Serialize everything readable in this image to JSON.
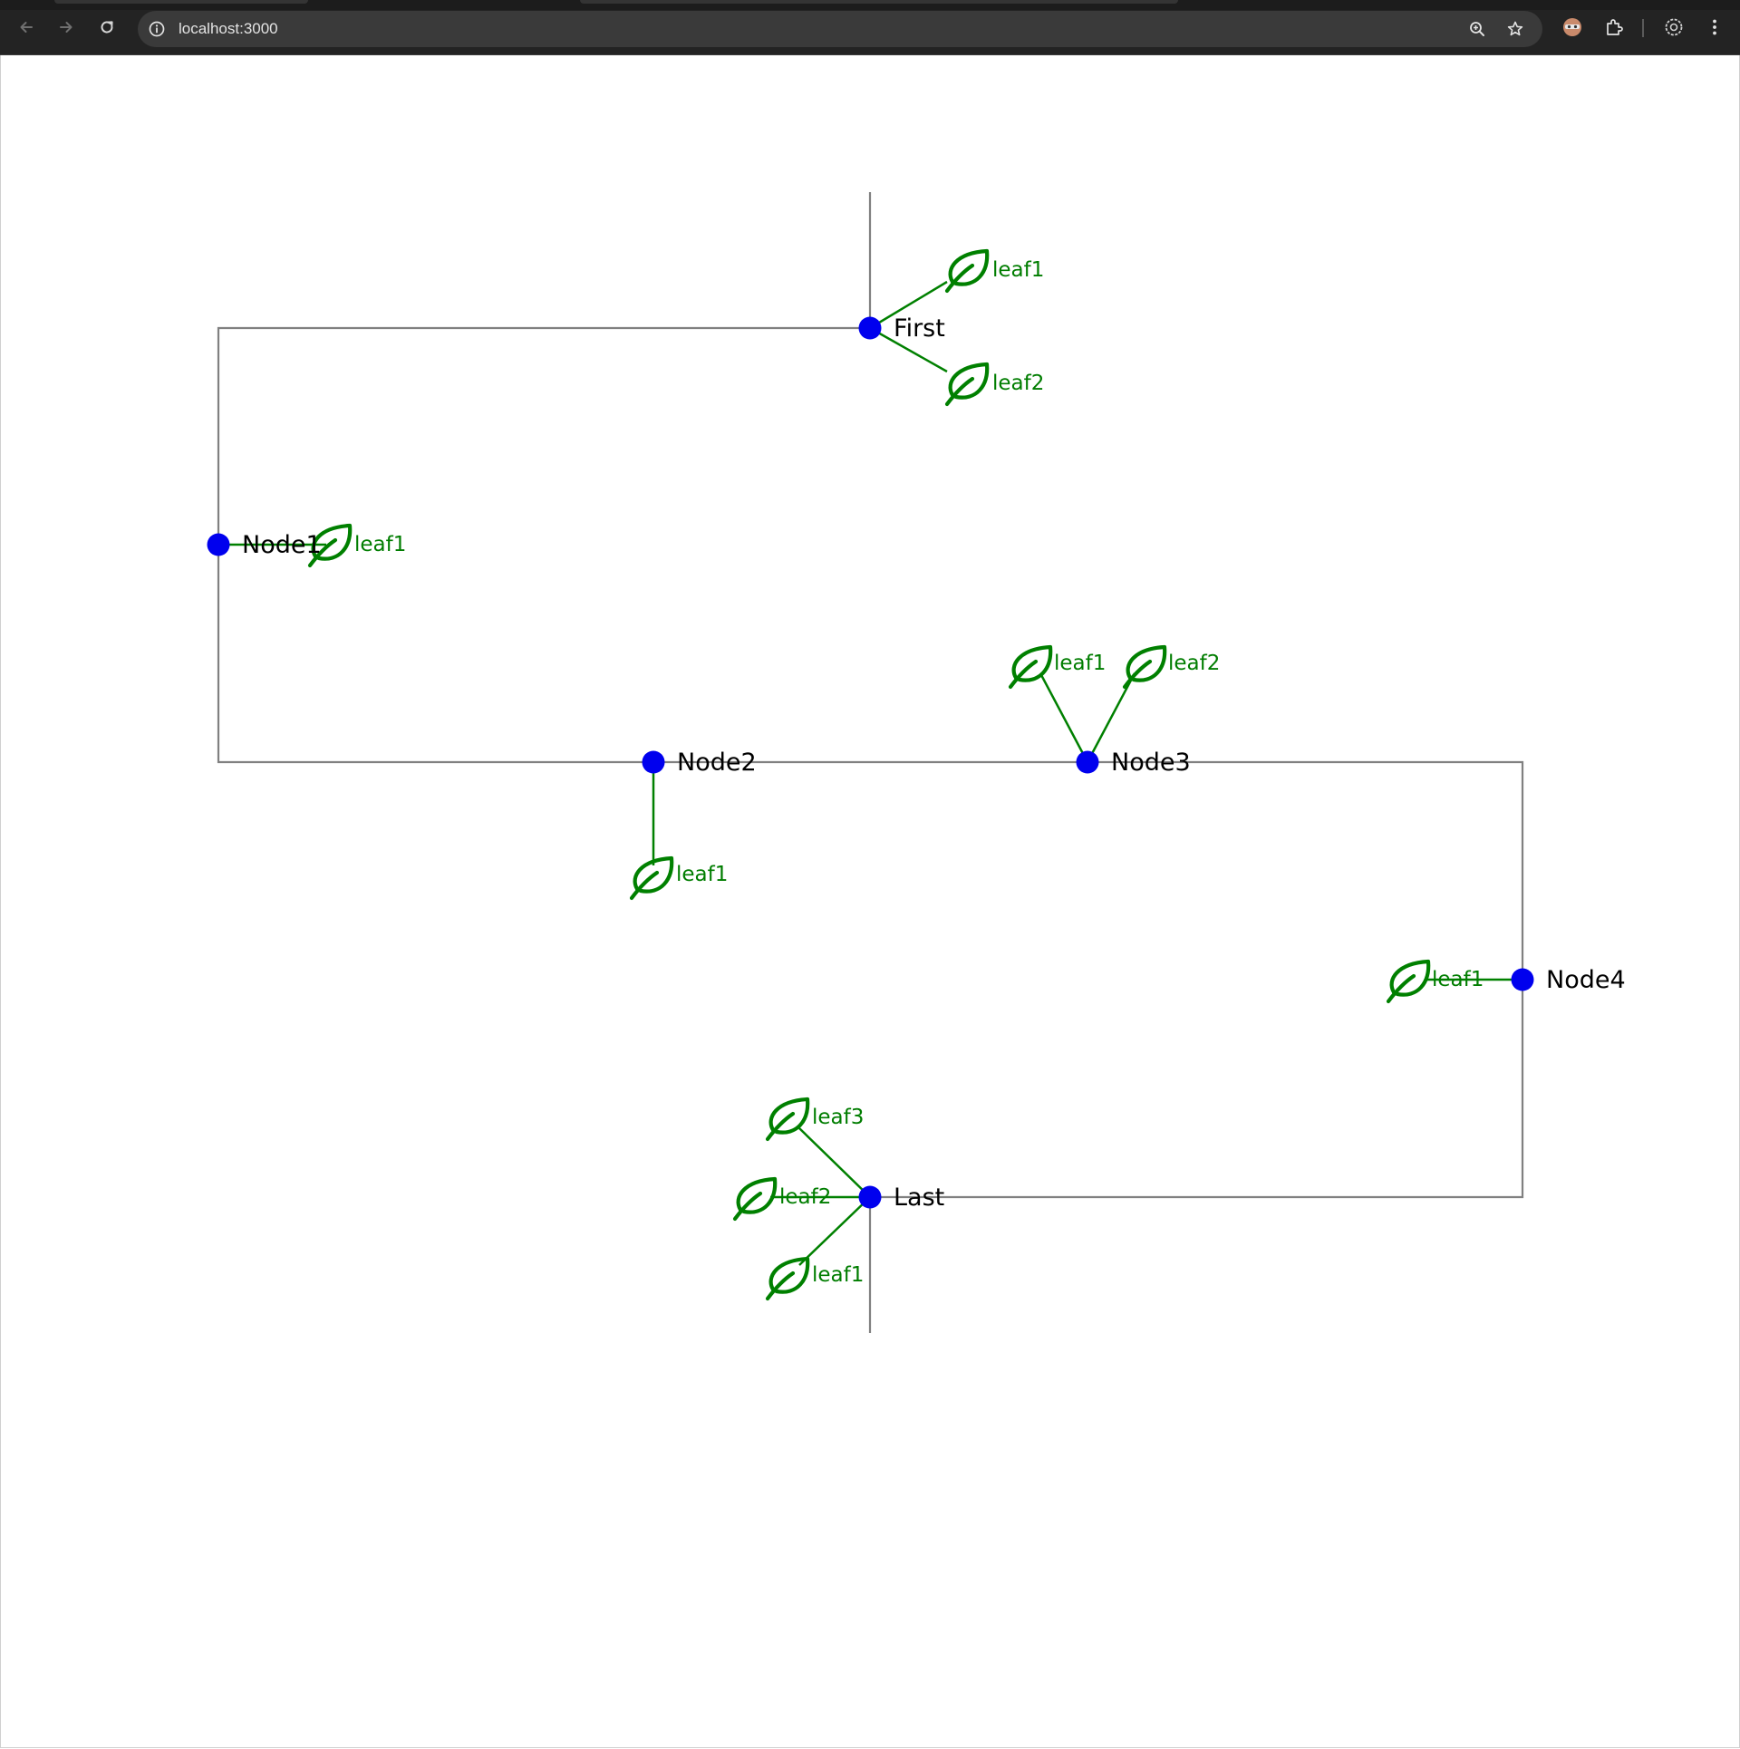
{
  "browser": {
    "url": "localhost:3000",
    "icons": {
      "back": "arrow-left-icon",
      "forward": "arrow-right-icon",
      "reload": "reload-icon",
      "site_info": "info-icon",
      "zoom": "zoom-in-icon",
      "bookmark": "star-icon",
      "profile_extension": "avatar-extension-icon",
      "extensions": "puzzle-icon",
      "settings_extension": "gear-icon",
      "menu": "kebab-menu-icon"
    }
  },
  "colors": {
    "node_fill": "#0000ee",
    "edge_stroke": "#808080",
    "leaf_stroke": "#008000",
    "leaf_label": "#007d00",
    "node_label": "#000000",
    "browser_chrome": "#232323"
  },
  "graph": {
    "nodes": [
      {
        "id": "first",
        "label": "First",
        "leaves": [
          {
            "label": "leaf1"
          },
          {
            "label": "leaf2"
          }
        ]
      },
      {
        "id": "node1",
        "label": "Node1",
        "leaves": [
          {
            "label": "leaf1"
          }
        ]
      },
      {
        "id": "node2",
        "label": "Node2",
        "leaves": [
          {
            "label": "leaf1"
          }
        ]
      },
      {
        "id": "node3",
        "label": "Node3",
        "leaves": [
          {
            "label": "leaf1"
          },
          {
            "label": "leaf2"
          }
        ]
      },
      {
        "id": "node4",
        "label": "Node4",
        "leaves": [
          {
            "label": "leaf1"
          }
        ]
      },
      {
        "id": "last",
        "label": "Last",
        "leaves": [
          {
            "label": "leaf1"
          },
          {
            "label": "leaf2"
          },
          {
            "label": "leaf3"
          }
        ]
      }
    ],
    "edges": [
      {
        "from": "first",
        "to": "node1"
      },
      {
        "from": "node1",
        "to": "node2"
      },
      {
        "from": "node2",
        "to": "node3"
      },
      {
        "from": "node3",
        "to": "node4"
      },
      {
        "from": "node4",
        "to": "last"
      }
    ],
    "leaf_icon": "leaf-icon"
  }
}
